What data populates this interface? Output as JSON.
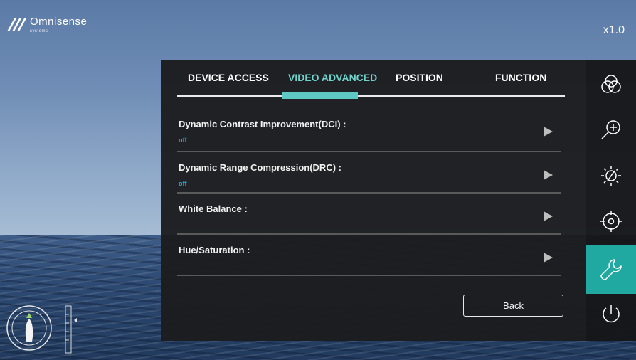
{
  "brand": {
    "name": "Omnisense",
    "subtitle": "systems"
  },
  "zoom_level": "x1.0",
  "tabs": [
    {
      "label": "DEVICE ACCESS",
      "active": false
    },
    {
      "label": "VIDEO ADVANCED",
      "active": true
    },
    {
      "label": "POSITION",
      "active": false
    },
    {
      "label": "FUNCTION",
      "active": false
    }
  ],
  "settings": [
    {
      "label": "Dynamic Contrast Improvement(DCI) :",
      "value": "off"
    },
    {
      "label": "Dynamic Range Compression(DRC) :",
      "value": "off"
    },
    {
      "label": "White Balance :",
      "value": ""
    },
    {
      "label": "Hue/Saturation :",
      "value": ""
    }
  ],
  "back_label": "Back",
  "sidebar": [
    {
      "icon": "color-circles-icon",
      "active": false
    },
    {
      "icon": "zoom-in-icon",
      "active": false
    },
    {
      "icon": "brightness-icon",
      "active": false
    },
    {
      "icon": "target-icon",
      "active": false
    },
    {
      "icon": "wrench-icon",
      "active": true
    },
    {
      "icon": "power-icon",
      "active": false
    }
  ],
  "colors": {
    "accent": "#5ec9c2",
    "active_sidebar": "#1fa9a1",
    "value_text": "#29a9e0"
  }
}
